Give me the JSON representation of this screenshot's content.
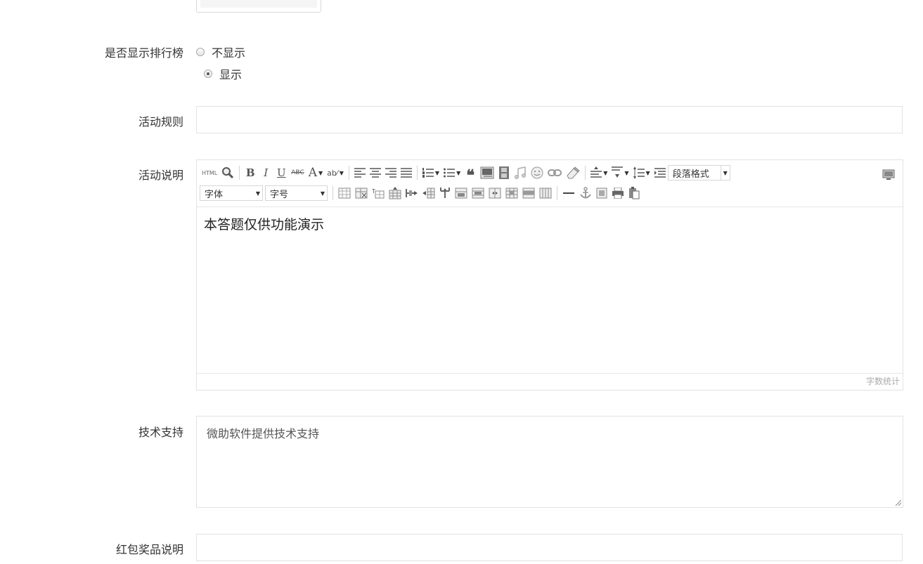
{
  "form": {
    "ranking": {
      "label": "是否显示排行榜",
      "options": [
        {
          "label": "不显示",
          "checked": false
        },
        {
          "label": "显示",
          "checked": true
        }
      ]
    },
    "rules": {
      "label": "活动规则",
      "value": ""
    },
    "description": {
      "label": "活动说明",
      "content": "本答题仅供功能演示",
      "word_count_label": "字数统计",
      "toolbar": {
        "html_label": "HTML",
        "bold": "B",
        "italic": "I",
        "underline": "U",
        "strike": "ABC",
        "fontcolor": "A",
        "backcolor": "ab",
        "paragraph_select": "段落格式",
        "font_select": "字体",
        "size_select": "字号"
      }
    },
    "support": {
      "label": "技术支持",
      "value": "微助软件提供技术支持"
    },
    "redpacket": {
      "label": "红包奖品说明",
      "value": ""
    }
  }
}
